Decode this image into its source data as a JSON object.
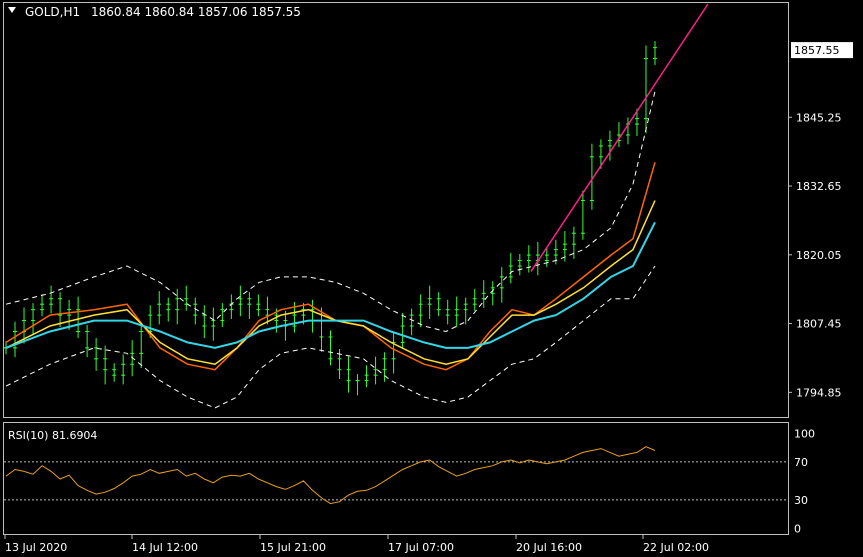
{
  "header": {
    "symbol": "GOLD,H1",
    "ohlc": "1860.84 1860.84 1857.06 1857.55",
    "menu_icon": "triangle-down-icon"
  },
  "rsi_header": {
    "label": "RSI(10) 81.6904"
  },
  "colors": {
    "background": "#000000",
    "frame": "#c0c0c0",
    "candle": "#33ff33",
    "ma_fast": "#ff6600",
    "ma_mid": "#ffe033",
    "ma_slow": "#33d6e6",
    "bands": "#ffffff",
    "trendline": "#ff1f8f",
    "rsi_line": "#e6a020",
    "price_tag_bg": "#ffffff",
    "price_tag_text": "#000000"
  },
  "chart_data": [
    {
      "type": "line",
      "title": "GOLD,H1",
      "subtitle": "1860.84 1860.84 1857.06 1857.55",
      "x_tick_labels": [
        "13 Jul 2020",
        "14 Jul 12:00",
        "15 Jul 21:00",
        "17 Jul 07:00",
        "20 Jul 16:00",
        "22 Jul 02:00"
      ],
      "y_tick_labels": [
        "1794.85",
        "1807.45",
        "1820.05",
        "1832.65",
        "1845.25"
      ],
      "ylim": [
        1790.7,
        1866.0
      ],
      "current_price": "1857.55",
      "grid": false,
      "x": [
        0,
        8,
        16,
        22,
        28,
        33,
        38,
        42,
        46,
        50,
        55,
        60,
        65,
        70,
        76,
        80,
        84,
        88,
        92,
        96,
        100,
        105,
        110,
        114,
        118
      ],
      "series": [
        {
          "values": [
            1804,
            1809,
            1810,
            1811,
            1803,
            1800,
            1799,
            1803,
            1808,
            1810,
            1811,
            1808,
            1807,
            1803,
            1800,
            1799,
            1801,
            1806,
            1810,
            1809,
            1812,
            1816,
            1820,
            1823,
            1837
          ]
        },
        {
          "values": [
            1803,
            1807,
            1809,
            1810,
            1804,
            1801,
            1800,
            1803,
            1807,
            1809,
            1810,
            1808,
            1807,
            1804,
            1801,
            1800,
            1801,
            1805,
            1809,
            1809,
            1811,
            1814,
            1818,
            1821,
            1830
          ]
        },
        {
          "values": [
            1803,
            1806,
            1808,
            1808,
            1806,
            1804,
            1803,
            1804,
            1806,
            1807,
            1808,
            1808,
            1808,
            1806,
            1804,
            1803,
            1803,
            1804,
            1806,
            1808,
            1809,
            1812,
            1816,
            1818,
            1826
          ]
        },
        {
          "values": [
            1811,
            1813,
            1816,
            1818,
            1815,
            1811,
            1808,
            1812,
            1815,
            1816,
            1816,
            1815,
            1813,
            1810,
            1807,
            1806,
            1808,
            1813,
            1817,
            1818,
            1819,
            1821,
            1825,
            1833,
            1850
          ]
        },
        {
          "values": [
            1796,
            1800,
            1803,
            1802,
            1797,
            1794,
            1792,
            1794,
            1799,
            1802,
            1803,
            1802,
            1801,
            1797,
            1794,
            1793,
            1794,
            1797,
            1800,
            1801,
            1804,
            1808,
            1812,
            1812,
            1818
          ]
        }
      ],
      "trendline": {
        "x": [
          100,
          120
        ],
        "y": [
          1817,
          1866
        ]
      },
      "candle_closes": [
        1803,
        1806,
        1808,
        1810,
        1811,
        1812,
        1809,
        1810,
        1806,
        1803,
        1801,
        1799,
        1798,
        1800,
        1802,
        1806,
        1809,
        1811,
        1810,
        1812,
        1811,
        1809,
        1807,
        1808,
        1810,
        1811,
        1812,
        1811,
        1810,
        1809,
        1808,
        1807,
        1809,
        1810,
        1808,
        1805,
        1801,
        1799,
        1797,
        1797,
        1798,
        1799,
        1801,
        1804,
        1807,
        1809,
        1811,
        1812,
        1810,
        1809,
        1810,
        1811,
        1812,
        1813,
        1814,
        1816,
        1818,
        1819,
        1820,
        1819,
        1820,
        1821,
        1822,
        1824,
        1830,
        1838,
        1840,
        1841,
        1842,
        1844,
        1845,
        1856,
        1858
      ]
    },
    {
      "type": "line",
      "title": "RSI(10) 81.6904",
      "y_tick_labels": [
        "100",
        "70",
        "30",
        "0"
      ],
      "ylim": [
        -5,
        110
      ],
      "levels": [
        70,
        30
      ],
      "values": [
        55,
        62,
        60,
        57,
        66,
        60,
        52,
        56,
        45,
        40,
        36,
        38,
        42,
        48,
        55,
        57,
        62,
        58,
        60,
        62,
        55,
        58,
        52,
        48,
        54,
        56,
        55,
        58,
        52,
        48,
        44,
        41,
        45,
        50,
        40,
        32,
        26,
        28,
        35,
        39,
        40,
        44,
        50,
        56,
        62,
        66,
        70,
        72,
        65,
        60,
        55,
        58,
        62,
        64,
        66,
        70,
        72,
        69,
        72,
        70,
        68,
        70,
        72,
        76,
        80,
        82,
        84,
        80,
        76,
        78,
        80,
        86,
        82
      ]
    }
  ]
}
